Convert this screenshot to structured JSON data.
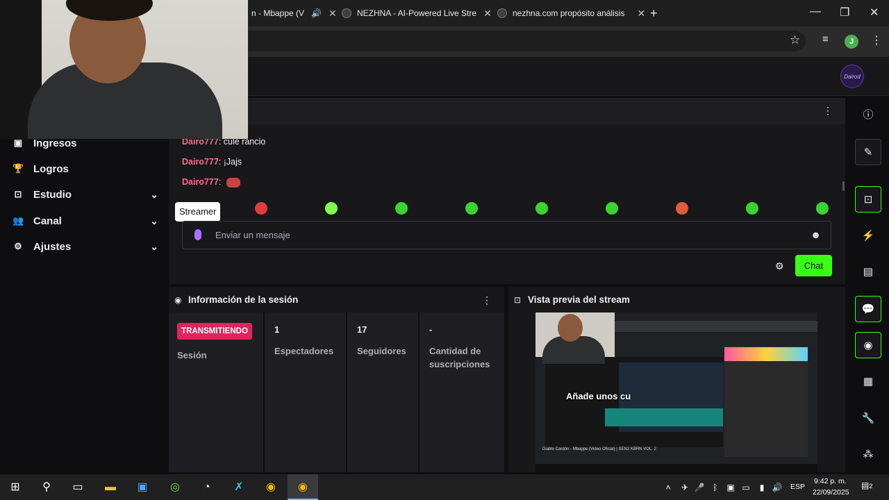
{
  "browser": {
    "tabs": [
      {
        "title": "n - Mbappe (V"
      },
      {
        "title": "NEZHNA - AI-Powered Live Stre"
      },
      {
        "title": "nezhna.com propósito análisis"
      }
    ],
    "new_tab": "+",
    "profile_initial": "J"
  },
  "app": {
    "logo_text": "Dairod"
  },
  "sidebar": {
    "items": [
      {
        "label": "Ingresos",
        "icon": "income-icon",
        "has_chevron": false
      },
      {
        "label": "Logros",
        "icon": "trophy-icon",
        "has_chevron": false
      },
      {
        "label": "Estudio",
        "icon": "studio-icon",
        "has_chevron": true
      },
      {
        "label": "Canal",
        "icon": "channel-icon",
        "has_chevron": true
      },
      {
        "label": "Ajustes",
        "icon": "gear-icon",
        "has_chevron": true
      }
    ]
  },
  "chat": {
    "messages": [
      {
        "user": "Dairo777",
        "text": ": culé rancio"
      },
      {
        "user": "Dairo777",
        "text": ": ¡Jajs"
      },
      {
        "user": "Dairo777",
        "text": ":"
      }
    ],
    "tooltip": "Streamer",
    "input_placeholder": "Enviar un mensaje",
    "send_label": "Chat",
    "emote_colors": [
      "#e03c3c",
      "#7dff4a",
      "#39d431",
      "#39d431",
      "#39d431",
      "#39d431",
      "#e05a3c",
      "#39d431",
      "#39d431"
    ]
  },
  "session": {
    "title": "Información de la sesión",
    "status_badge": "TRANSMITIENDO",
    "session_label": "Sesión",
    "viewers_value": "1",
    "viewers_label": "Espectadores",
    "followers_value": "17",
    "followers_label": "Seguidores",
    "subs_value": "-",
    "subs_label_1": "Cantidad de",
    "subs_label_2": "suscripciones"
  },
  "preview": {
    "title": "Vista previa del stream",
    "caption": "Añade unos cu",
    "footer_text": "Diablo Cardón - Mbappe (Video Oficial) | SEN2 KBRN VOL. 2"
  },
  "taskbar": {
    "language": "ESP",
    "time": "9:42 p. m.",
    "date": "22/09/2025",
    "notifications": "2"
  },
  "colors": {
    "accent": "#39ff14",
    "username": "#ff6b8b",
    "live": "#e0245e",
    "mic": "#a970ff"
  }
}
